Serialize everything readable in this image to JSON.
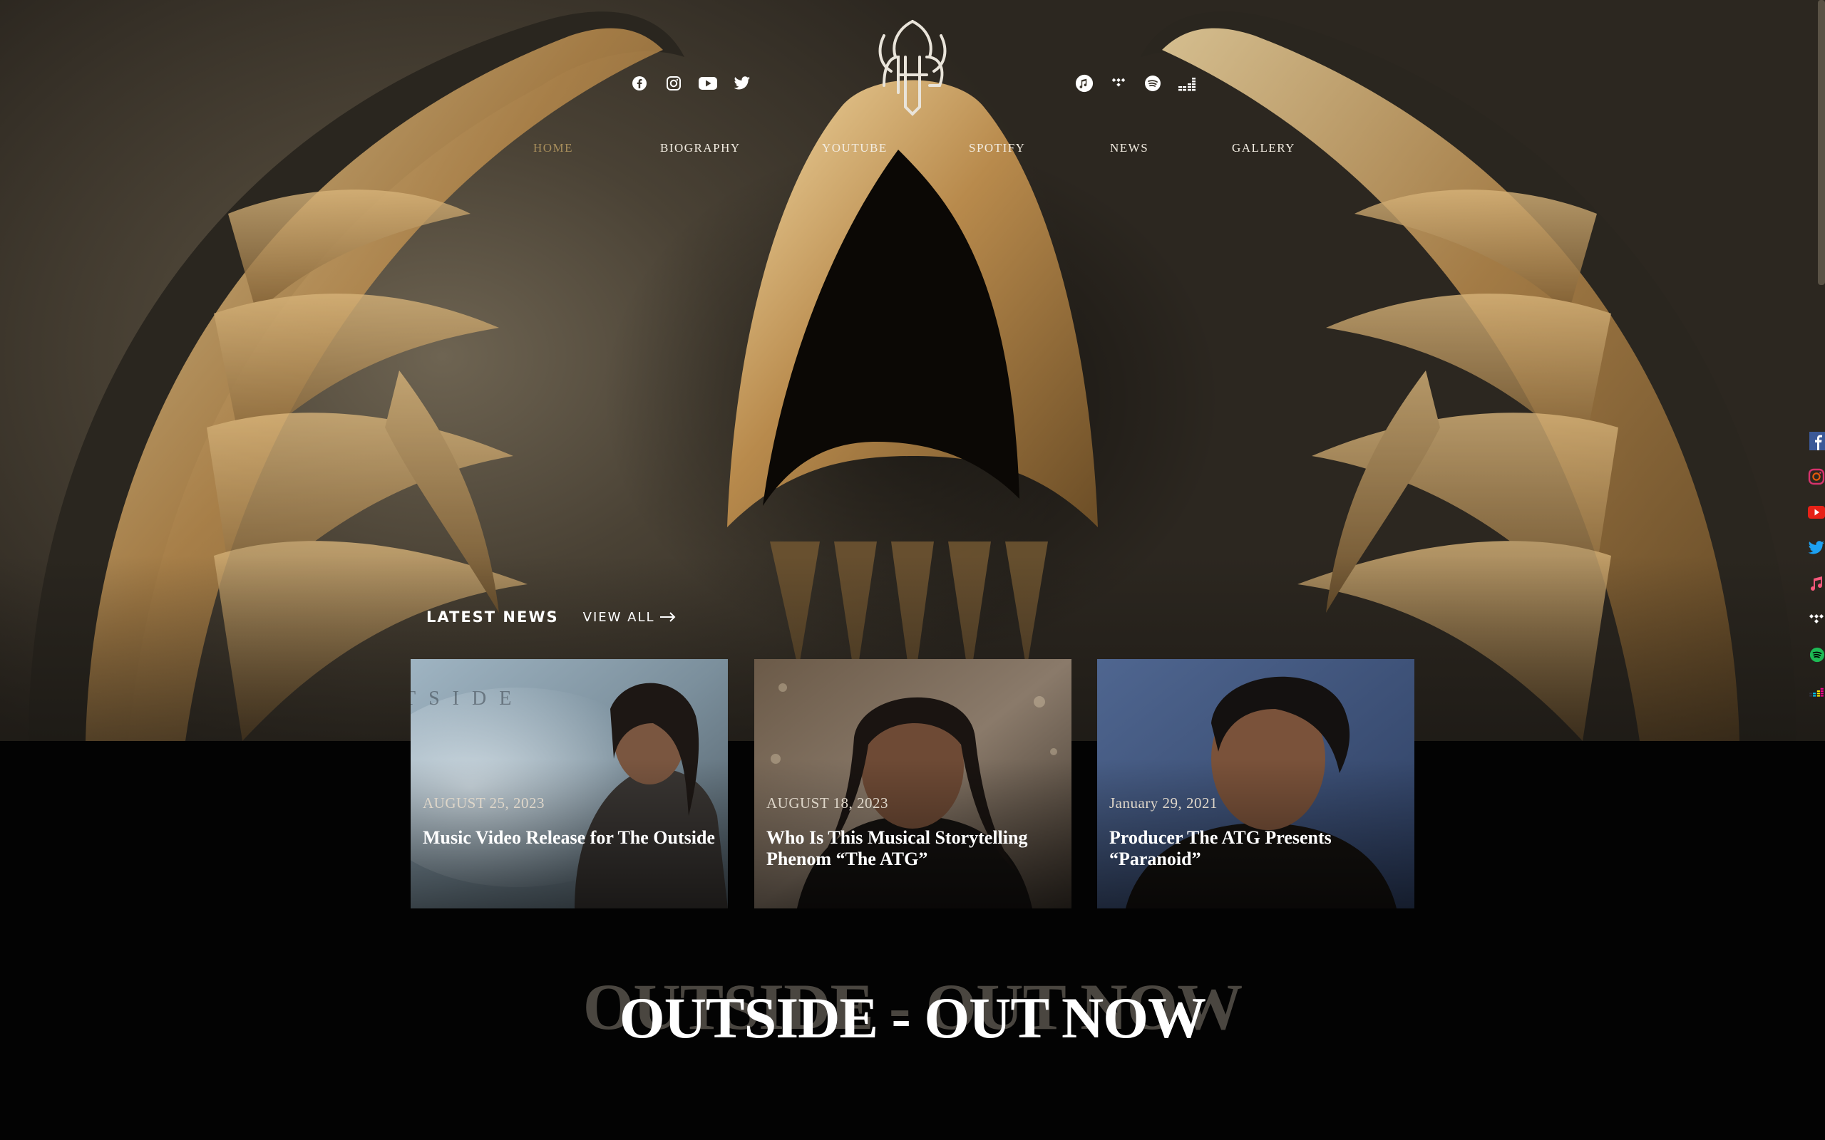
{
  "header": {
    "logo_name": "The ATG logo",
    "social_left": [
      {
        "icon": "facebook-icon"
      },
      {
        "icon": "instagram-icon"
      },
      {
        "icon": "youtube-icon"
      },
      {
        "icon": "twitter-icon"
      }
    ],
    "social_right": [
      {
        "icon": "apple-music-icon"
      },
      {
        "icon": "tidal-icon"
      },
      {
        "icon": "spotify-icon"
      },
      {
        "icon": "deezer-icon"
      }
    ]
  },
  "nav": {
    "items": [
      {
        "label": "HOME",
        "active": true
      },
      {
        "label": "BIOGRAPHY",
        "active": false
      },
      {
        "label": "YOUTUBE",
        "active": false
      },
      {
        "label": "SPOTIFY",
        "active": false
      },
      {
        "label": "NEWS",
        "active": false
      },
      {
        "label": "GALLERY",
        "active": false
      }
    ]
  },
  "news": {
    "title": "LATEST NEWS",
    "view_all": "VIEW ALL",
    "cards": [
      {
        "date": "AUGUST 25, 2023",
        "title": "Music Video Release for The Outside",
        "overlay_text": "TSIDE"
      },
      {
        "date": "AUGUST 18, 2023",
        "title": "Who Is This Musical Storytelling Phenom “The ATG”"
      },
      {
        "date": "January 29, 2021",
        "title": "Producer The ATG Presents “Paranoid”"
      }
    ]
  },
  "release": {
    "headline": "OUTSIDE - OUT NOW",
    "ghost_headline": "OUTSIDE - OUT NOW"
  },
  "side_strip": [
    "facebook-icon",
    "instagram-icon",
    "youtube-icon",
    "twitter-icon",
    "apple-music-icon",
    "tidal-icon",
    "spotify-icon",
    "deezer-icon"
  ],
  "colors": {
    "background": "#030303",
    "nav_active": "#a98f5c",
    "gold": "#c9a46a"
  }
}
